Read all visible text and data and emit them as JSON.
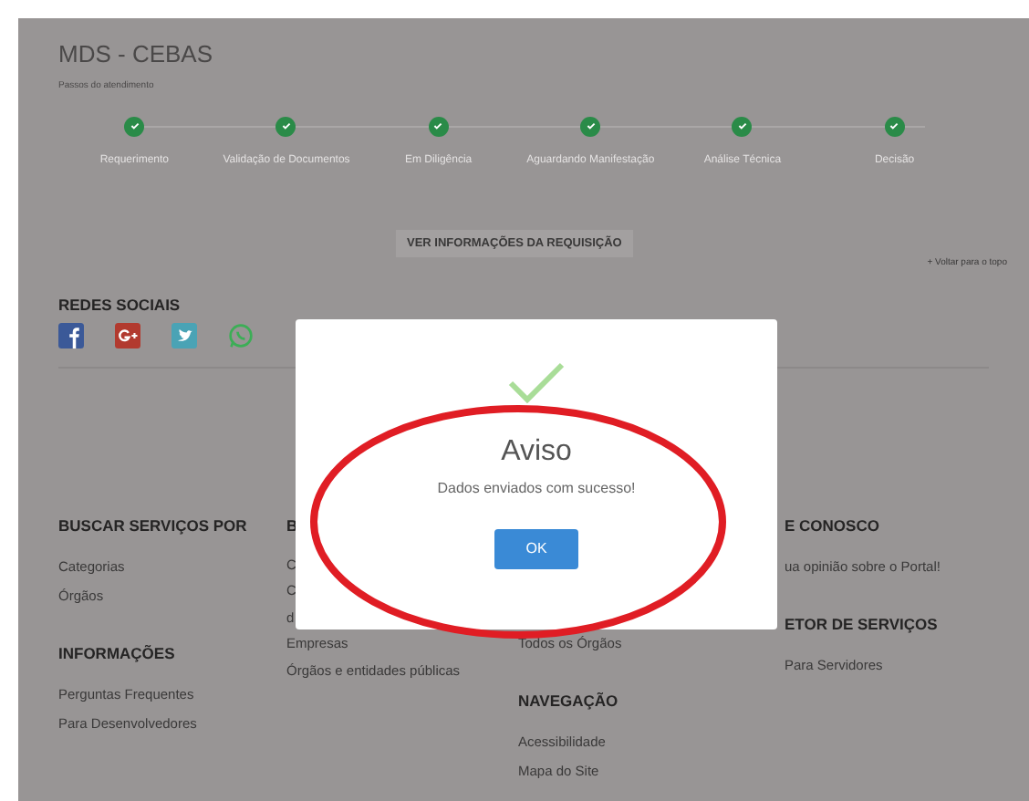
{
  "header": {
    "title": "MDS - CEBAS",
    "subtitle": "Passos do atendimento"
  },
  "steps": [
    {
      "label": "Requerimento",
      "done": true
    },
    {
      "label": "Validação de Documentos",
      "done": true
    },
    {
      "label": "Em Diligência",
      "done": true
    },
    {
      "label": "Aguardando Manifestação",
      "done": true
    },
    {
      "label": "Análise Técnica",
      "done": true
    },
    {
      "label": "Decisão",
      "done": true
    }
  ],
  "details_button": "VER INFORMAÇÕES DA REQUISIÇÃO",
  "back_to_top": "+ Voltar para o topo",
  "social": {
    "heading": "REDES SOCIAIS",
    "icons": [
      {
        "kind": "facebook",
        "color": "#3b5998"
      },
      {
        "kind": "googleplus",
        "color": "#b23a2f"
      },
      {
        "kind": "twitter",
        "color": "#4aa3b5"
      },
      {
        "kind": "whatsapp",
        "color": "#3cae56"
      }
    ]
  },
  "footer": [
    {
      "sections": [
        {
          "heading": "BUSCAR SERVIÇOS POR",
          "links": [
            "Categorias",
            "Órgãos"
          ]
        },
        {
          "heading": "INFORMAÇÕES",
          "links": [
            "Perguntas Frequentes",
            "Para Desenvolvedores"
          ]
        }
      ]
    },
    {
      "sections": [
        {
          "heading": "B",
          "links": [
            "C",
            "C",
            "d",
            "Empresas",
            "Órgãos e entidades públicas"
          ]
        }
      ]
    },
    {
      "sections": [
        {
          "links": [
            "Todos os Órgãos"
          ]
        },
        {
          "heading": "NAVEGAÇÃO",
          "links": [
            "Acessibilidade",
            "Mapa do Site"
          ]
        }
      ]
    },
    {
      "sections": [
        {
          "heading": "E CONOSCO",
          "links": [
            "ua opinião sobre o Portal!"
          ]
        },
        {
          "heading": "ETOR DE SERVIÇOS",
          "links": [
            "Para Servidores"
          ]
        }
      ]
    }
  ],
  "dialog": {
    "title": "Aviso",
    "message": "Dados enviados com sucesso!",
    "button": "OK",
    "highlighted": true
  }
}
